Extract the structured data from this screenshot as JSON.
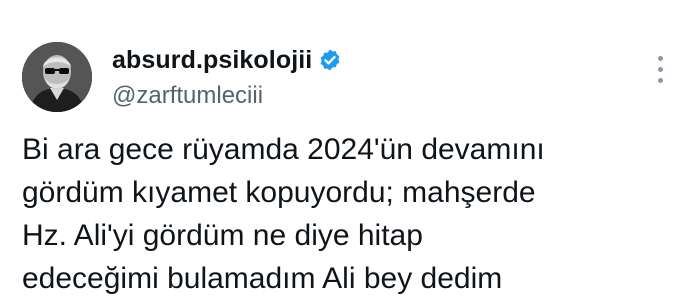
{
  "tweet": {
    "author": {
      "display_name": "absurd.psikolojii",
      "handle": "@zarftumleciii",
      "verified": true,
      "verified_color": "#1d9bf0"
    },
    "body_lines": [
      "Bi ara gece rüyamda 2024'ün devamını",
      "gördüm kıyamet kopuyordu; mahşerde",
      "Hz. Ali'yi gördüm ne diye hitap",
      "edeceğimi bulamadım Ali bey dedim"
    ]
  },
  "icons": {
    "verified": "verified-badge-icon",
    "more": "more-options-icon"
  }
}
